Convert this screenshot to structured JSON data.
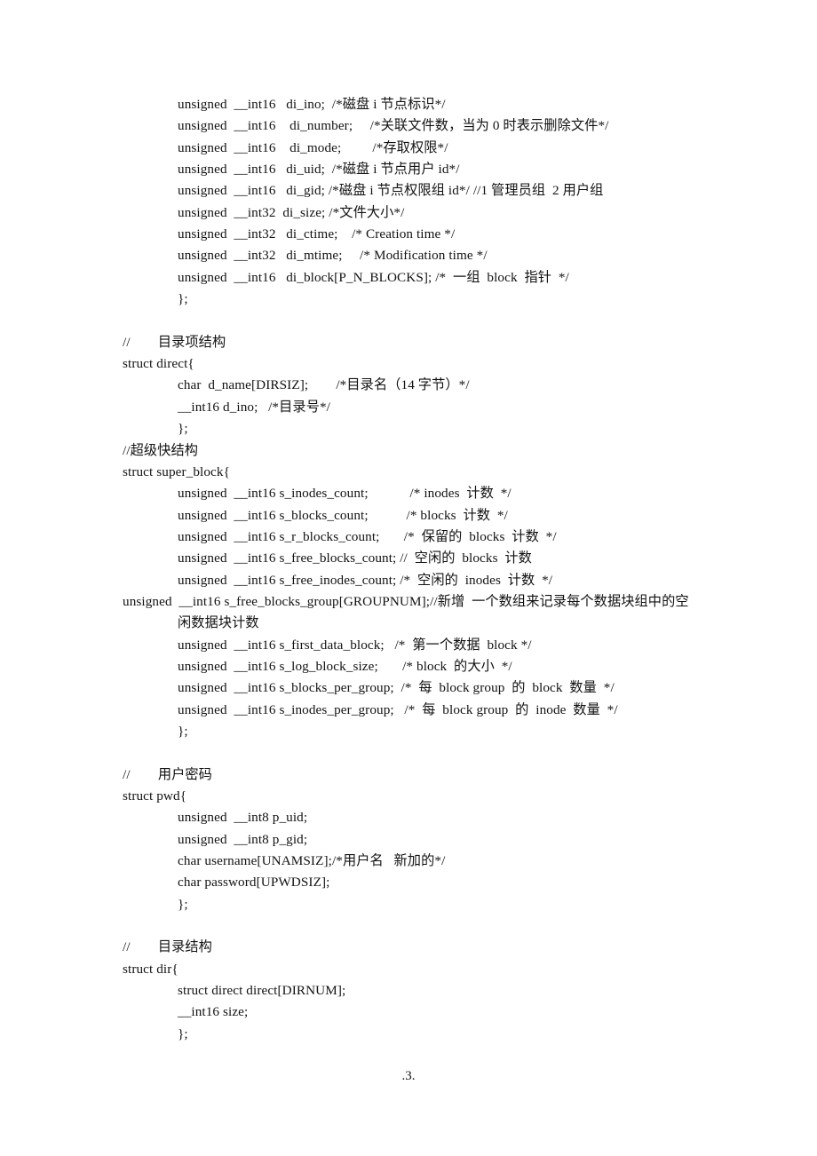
{
  "document": {
    "page_footer": ".3.",
    "body_lines": [
      {
        "indent": 1,
        "text": "unsigned  __int16   di_ino;  /*磁盘 i 节点标识*/"
      },
      {
        "indent": 1,
        "text": "unsigned  __int16    di_number;     /*关联文件数，当为 0 时表示删除文件*/"
      },
      {
        "indent": 1,
        "text": "unsigned  __int16    di_mode;         /*存取权限*/"
      },
      {
        "indent": 1,
        "text": "unsigned  __int16   di_uid;  /*磁盘 i 节点用户 id*/"
      },
      {
        "indent": 1,
        "text": "unsigned  __int16   di_gid; /*磁盘 i 节点权限组 id*/ //1 管理员组  2 用户组"
      },
      {
        "indent": 1,
        "text": "unsigned  __int32  di_size; /*文件大小*/"
      },
      {
        "indent": 1,
        "text": "unsigned  __int32   di_ctime;    /* Creation time */"
      },
      {
        "indent": 1,
        "text": "unsigned  __int32   di_mtime;     /* Modification time */"
      },
      {
        "indent": 1,
        "text": "unsigned  __int16   di_block[P_N_BLOCKS]; /*  一组  block  指针  */"
      },
      {
        "indent": 1,
        "text": "};"
      },
      {
        "indent": 0,
        "text": "",
        "blank": true
      },
      {
        "indent": 0,
        "text": "//        目录项结构"
      },
      {
        "indent": 0,
        "text": "struct direct{"
      },
      {
        "indent": 1,
        "text": "char  d_name[DIRSIZ];        /*目录名（14 字节）*/"
      },
      {
        "indent": 1,
        "text": "__int16 d_ino;   /*目录号*/"
      },
      {
        "indent": 1,
        "text": "};"
      },
      {
        "indent": 0,
        "text": "//超级快结构"
      },
      {
        "indent": 0,
        "text": "struct super_block{"
      },
      {
        "indent": 1,
        "text": "unsigned  __int16 s_inodes_count;            /* inodes  计数  */"
      },
      {
        "indent": 1,
        "text": "unsigned  __int16 s_blocks_count;           /* blocks  计数  */"
      },
      {
        "indent": 1,
        "text": "unsigned  __int16 s_r_blocks_count;       /*  保留的  blocks  计数  */"
      },
      {
        "indent": 1,
        "text": "unsigned  __int16 s_free_blocks_count; //  空闲的  blocks  计数"
      },
      {
        "indent": 1,
        "text": "unsigned  __int16 s_free_inodes_count; /*  空闲的  inodes  计数  */"
      },
      {
        "indent": 1,
        "wrap": true,
        "text": "unsigned  __int16 s_free_blocks_group[GROUPNUM];//新增  一个数组来记录每个数据块组中的空闲数据块计数"
      },
      {
        "indent": 1,
        "text": "unsigned  __int16 s_first_data_block;   /*  第一个数据  block */"
      },
      {
        "indent": 1,
        "text": "unsigned  __int16 s_log_block_size;       /* block  的大小  */"
      },
      {
        "indent": 1,
        "text": "unsigned  __int16 s_blocks_per_group;  /*  每  block group  的  block  数量  */"
      },
      {
        "indent": 1,
        "text": "unsigned  __int16 s_inodes_per_group;   /*  每  block group  的  inode  数量  */"
      },
      {
        "indent": 1,
        "text": "};"
      },
      {
        "indent": 0,
        "text": "",
        "blank": true
      },
      {
        "indent": 0,
        "text": "//        用户密码"
      },
      {
        "indent": 0,
        "text": "struct pwd{"
      },
      {
        "indent": 1,
        "text": "unsigned  __int8 p_uid;"
      },
      {
        "indent": 1,
        "text": "unsigned  __int8 p_gid;"
      },
      {
        "indent": 1,
        "text": "char username[UNAMSIZ];/*用户名   新加的*/"
      },
      {
        "indent": 1,
        "text": "char password[UPWDSIZ];"
      },
      {
        "indent": 1,
        "text": "};"
      },
      {
        "indent": 0,
        "text": "",
        "blank": true
      },
      {
        "indent": 0,
        "text": "//        目录结构"
      },
      {
        "indent": 0,
        "text": "struct dir{"
      },
      {
        "indent": 1,
        "text": "struct direct direct[DIRNUM];"
      },
      {
        "indent": 1,
        "text": "__int16 size;"
      },
      {
        "indent": 1,
        "text": "};"
      }
    ]
  }
}
